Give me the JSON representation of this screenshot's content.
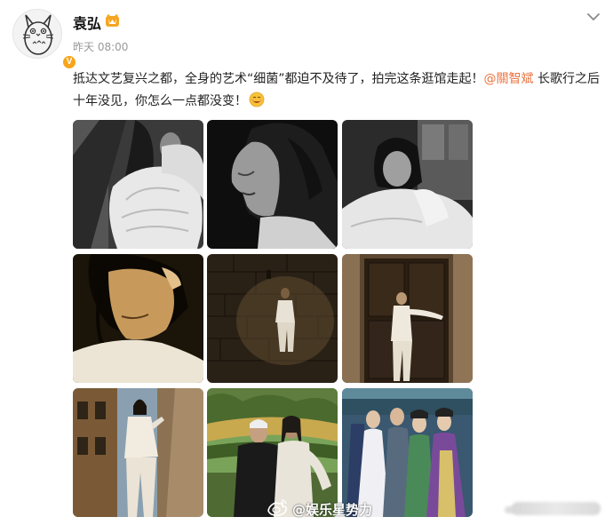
{
  "post": {
    "author": "袁弘",
    "time": "昨天 08:00",
    "verified_badge": "V",
    "text_main": "抵达文艺复兴之都，全身的艺术“细菌”都迫不及待了，拍完这条逛馆走起！",
    "mention": "@關智斌",
    "text_tail": " 长歌行之后十年没见，你怎么一点都没变！",
    "emoji": "smile-emoji"
  },
  "photos": [
    {
      "name": "photo-1",
      "desc": "bw-man-white-shirt-arm-raised"
    },
    {
      "name": "photo-2",
      "desc": "bw-profile-portrait"
    },
    {
      "name": "photo-3",
      "desc": "bw-man-seated-by-window"
    },
    {
      "name": "photo-4",
      "desc": "color-closeup-face-sunlight"
    },
    {
      "name": "photo-5",
      "desc": "man-white-suit-stone-wall"
    },
    {
      "name": "photo-6",
      "desc": "man-white-suit-doorway"
    },
    {
      "name": "photo-7",
      "desc": "man-leaning-on-wall-street"
    },
    {
      "name": "photo-8",
      "desc": "two-men-garden-selfie"
    },
    {
      "name": "photo-9",
      "desc": "costume-drama-group-photo"
    }
  ],
  "watermark": {
    "text": "@娱乐星势力"
  },
  "colors": {
    "mention": "#eb7340",
    "badge": "#f7a51c",
    "timestamp": "#999999"
  },
  "icons": [
    "menu-chevron-icon",
    "member-crown-icon",
    "weibo-logo-icon",
    "v-badge-icon"
  ]
}
